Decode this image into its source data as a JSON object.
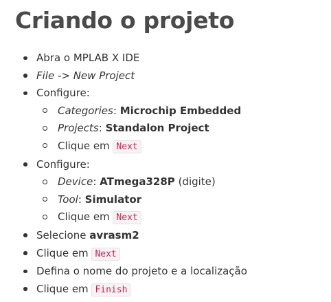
{
  "title": "Criando o projeto",
  "steps": [
    {
      "text": "Abra o MPLAB X IDE"
    },
    {
      "text": "File -> New Project"
    },
    {
      "text": "Configure:",
      "sub": [
        {
          "label": "Categories",
          "sep": ": ",
          "value": "Microchip Embedded"
        },
        {
          "label": "Projects",
          "sep": ": ",
          "value": "Standalon Project"
        },
        {
          "text": "Clique em ",
          "code": "Next"
        }
      ]
    },
    {
      "text": "Configure:",
      "sub": [
        {
          "label": "Device",
          "sep": ": ",
          "value": "ATmega328P",
          "after": " (digite)"
        },
        {
          "label": "Tool",
          "sep": ": ",
          "value": "Simulator"
        },
        {
          "text": "Clique em ",
          "code": "Next"
        }
      ]
    },
    {
      "text": "Selecione ",
      "bold": "avrasm2"
    },
    {
      "text": "Clique em ",
      "code": "Next"
    },
    {
      "text": "Defina o nome do projeto e a localização"
    },
    {
      "text": "Clique em ",
      "code": "Finish"
    }
  ]
}
